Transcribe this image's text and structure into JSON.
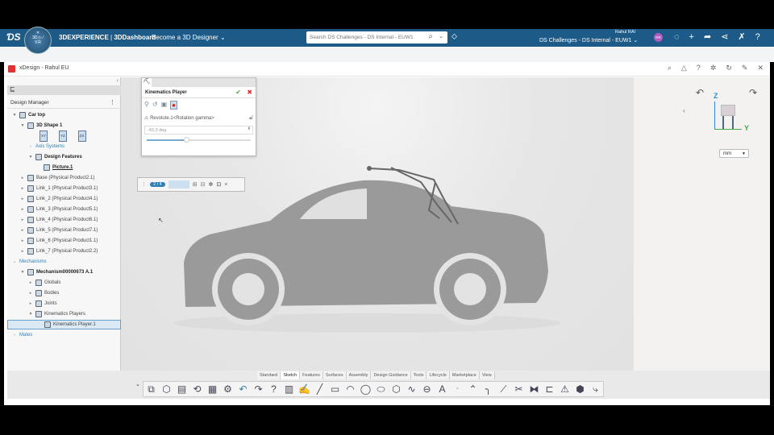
{
  "header": {
    "brand": "3DEXPERIENCE",
    "separator": " | ",
    "app": "3DDashboard",
    "dashboard": "Become a 3D Designer",
    "search_placeholder": "Search DS Challenges - DS Internal - EUW1",
    "user_name": "Rahul RAI",
    "tenant": "DS Challenges - DS Internal - EUW1",
    "avatar_initials": "RR",
    "compass_label": "V.R",
    "compass_3d": "3D"
  },
  "window": {
    "title": "xDesign - Rahul EU"
  },
  "design_manager": {
    "title": "Design Manager",
    "tree": [
      {
        "label": "Car top",
        "level": 0,
        "toggle": "▼",
        "bold": true
      },
      {
        "label": "3D Shape 1",
        "level": 1,
        "toggle": "▼",
        "bold": true
      },
      {
        "label": "Axis Systems",
        "level": 2,
        "toggle": "›",
        "blue": true
      },
      {
        "label": "Design Features",
        "level": 2,
        "toggle": "▼",
        "bold": true
      },
      {
        "label": "Picture.1",
        "level": 3,
        "toggle": "",
        "bold": true,
        "underline": true
      },
      {
        "label": "Base (Physical Product2.1)",
        "level": 1,
        "toggle": "▸"
      },
      {
        "label": "Link_1 (Physical Product3.1)",
        "level": 1,
        "toggle": "▸"
      },
      {
        "label": "Link_2 (Physical Product4.1)",
        "level": 1,
        "toggle": "▸"
      },
      {
        "label": "Link_3 (Physical Product5.1)",
        "level": 1,
        "toggle": "▸"
      },
      {
        "label": "Link_4 (Physical Product6.1)",
        "level": 1,
        "toggle": "▸"
      },
      {
        "label": "Link_5 (Physical Product7.1)",
        "level": 1,
        "toggle": "▸"
      },
      {
        "label": "Link_6 (Physical Product1.1)",
        "level": 1,
        "toggle": "▸"
      },
      {
        "label": "Link_7 (Physical Product2.2)",
        "level": 1,
        "toggle": "▸"
      },
      {
        "label": "Mechanisms",
        "level": 0,
        "toggle": "⌄",
        "blue": true
      },
      {
        "label": "Mechanism00000673 A.1",
        "level": 1,
        "toggle": "▼",
        "bold": true
      },
      {
        "label": "Globals",
        "level": 2,
        "toggle": "▸"
      },
      {
        "label": "Bodies",
        "level": 2,
        "toggle": "▸"
      },
      {
        "label": "Joints",
        "level": 2,
        "toggle": "▸"
      },
      {
        "label": "Kinematics Players",
        "level": 2,
        "toggle": "▼"
      },
      {
        "label": "Kinematics Player.1",
        "level": 3,
        "toggle": "",
        "selected": true
      },
      {
        "label": "Mates",
        "level": 0,
        "toggle": "›",
        "blue": true
      }
    ],
    "planes": [
      "XY",
      "YZ",
      "ZX"
    ]
  },
  "kinematics_player": {
    "title": "Kinematics Player",
    "joint": "Revolute.1<Rotation gamma>",
    "value": "-43.3 deg",
    "slider_percent": 38
  },
  "player_bar": {
    "step": "2 / 4"
  },
  "view": {
    "unit": "mm",
    "axis_z": "Z",
    "axis_y": "Y"
  },
  "toolbar": {
    "tabs": [
      "Standard",
      "Sketch",
      "Features",
      "Surfaces",
      "Assembly",
      "Design Guidance",
      "Tools",
      "Lifecycle",
      "Marketplace",
      "View"
    ],
    "active_tab": "Sketch"
  },
  "colors": {
    "header": "#1d5a87",
    "accent": "#2f7fb5",
    "car": "#9a9a9a"
  }
}
